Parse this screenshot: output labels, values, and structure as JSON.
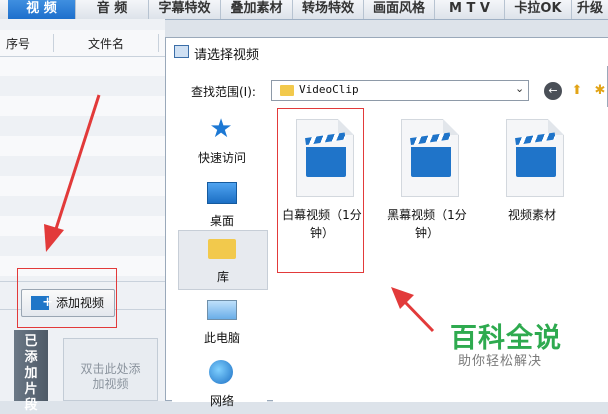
{
  "tabs": [
    "视 频",
    "音 频",
    "字幕特效",
    "叠加素材",
    "转场特效",
    "画面风格",
    "M T V",
    "卡拉OK",
    "升级"
  ],
  "left_pane": {
    "columns": [
      "序号",
      "文件名"
    ],
    "add_button": "添加视频",
    "vertical_label": "已添加片段",
    "drop_hint": "双击此处添加视频"
  },
  "dialog": {
    "title": "请选择视频",
    "look_in_label": "查找范围(I):",
    "path": "VideoClip",
    "places": [
      "快速访问",
      "桌面",
      "库",
      "此电脑",
      "网络"
    ],
    "files": [
      {
        "name": "白幕视频（1分钟）"
      },
      {
        "name": "黑幕视频（1分钟）"
      },
      {
        "name": "视频素材"
      }
    ]
  },
  "watermark": {
    "title": "百科全说",
    "subtitle": "助你轻松解决"
  },
  "colors": {
    "accent": "#1f74c9",
    "highlight": "#e23a3a",
    "watermark": "#2eaa4f"
  }
}
